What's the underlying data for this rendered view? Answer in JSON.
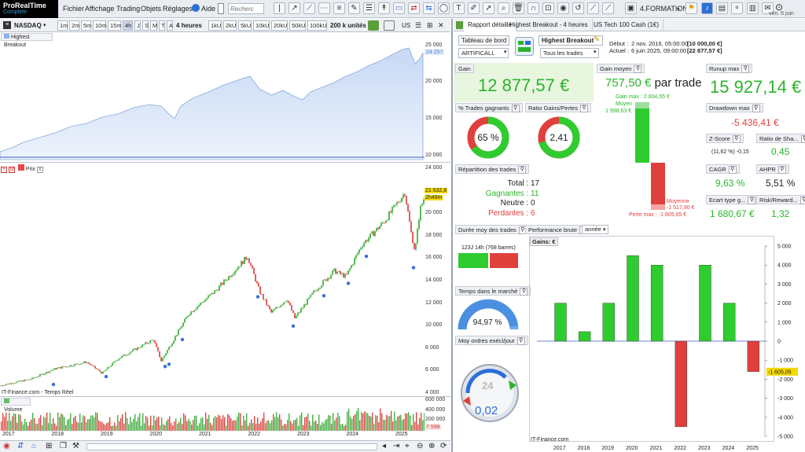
{
  "topbar": {
    "logo_title": "ProRealTime",
    "logo_sub": "Complete",
    "menus": [
      "Fichier",
      "Affichage",
      "Trading",
      "Objets",
      "Réglages",
      "Aide"
    ],
    "search_placeholder": "Recherc",
    "workspace": "4.FORMATION",
    "date": "ven. 6 juin"
  },
  "chart_toolbar": {
    "instrument": "NASDAQ",
    "timeframes": [
      "1m",
      "2m",
      "5m",
      "10m",
      "15m",
      "4h",
      "J",
      "S",
      "M",
      "T",
      "A"
    ],
    "period": "4 heures",
    "ticks": [
      "1kU",
      "2kU",
      "5kU",
      "10kU",
      "20kU",
      "50kU",
      "100kU"
    ],
    "units": "200 k unités",
    "region": "US"
  },
  "left_chart": {
    "equity_label": "Highest Breakout",
    "equity_axis": [
      "25 000",
      "20 000",
      "15 000",
      "10 000"
    ],
    "equity_last": "24 257",
    "price_label": "Prix",
    "price_axis": [
      "24 000",
      "22 000",
      "20 000",
      "18 000",
      "16 000",
      "14 000",
      "12 000",
      "10 000",
      "8 000",
      "6 000",
      "4 000"
    ],
    "price_last": "21 632,8",
    "countdown": "2h49m",
    "source": "IT-Finance.com - Temps Réel",
    "volume_label": "Volume",
    "volume_axis": [
      "600 000",
      "400 000",
      "200 000"
    ],
    "volume_last": "7 598",
    "years": [
      "2017",
      "2018",
      "2019",
      "2020",
      "2021",
      "2022",
      "2023",
      "2024",
      "2025"
    ]
  },
  "report": {
    "tabs": [
      "Rapport détaillé",
      "Highest Breakout - 4 heures",
      "US Tech 100 Cash (1€)"
    ],
    "dashboard_label": "Tableau de bord",
    "dashboard_value": "ARTIFICALL",
    "system_name": "Highest Breakout",
    "trades_filter": "Tous les trades",
    "debut_label": "Début :",
    "debut_value": "2 nov. 2016, 05:00:00",
    "debut_capital": "[10 000,00 €]",
    "actuel_label": "Actuel :",
    "actuel_value": "6 juin 2025, 09:00:00",
    "actuel_capital": "[22 877,57 €]",
    "gain_label": "Gain",
    "gain_value": "12 877,57 €",
    "gain_moyen_label": "Gain moyen",
    "gain_moyen_value": "757,50 €",
    "gain_moyen_suffix": "par trade",
    "gain_max": "Gain max : 2 004,55 €",
    "moyen_label": "Moyen",
    "moyen_value": "1 998,63 €",
    "moyenne_label": "Moyenne",
    "moyenne_value": "-1 517,90 €",
    "perte_max": "Perte max : -1 605,05 €",
    "runup_label": "Runup max",
    "runup_value": "15 927,14 €",
    "drawdown_label": "Drawdown max",
    "drawdown_value": "-5 436,41 €",
    "pct_gagnants_label": "% Trades gagnants",
    "pct_gagnants_value": "65 %",
    "ratio_label": "Ratio Gains/Pertes",
    "ratio_value": "2,41",
    "zscore_label": "Z-Score",
    "zscore_sub": "(11,62 %) -0,15",
    "sharpe_label": "Ratio de Sha...",
    "sharpe_value": "0,45",
    "repartition_label": "Répartition des trades",
    "total_label": "Total :",
    "total_value": "17",
    "gagnantes_label": "Gagnantes :",
    "gagnantes_value": "11",
    "neutre_label": "Neutre :",
    "neutre_value": "0",
    "perdantes_label": "Perdantes :",
    "perdantes_value": "6",
    "cagr_label": "CAGR",
    "cagr_value": "9,63 %",
    "ahpr_label": "AHPR",
    "ahpr_value": "5,51 %",
    "ecart_label": "Ecart type g...",
    "ecart_value": "1 680,67 €",
    "risk_label": "Risk/Reward...",
    "risk_value": "1,32",
    "duree_label": "Durée moy des trades",
    "duree_value": "123J 14h (768 barres)",
    "temps_label": "Temps dans le marché",
    "temps_value": "94,97 %",
    "moy_ordres_label": "Moy ordres exécl/jour",
    "moy_ordres_value": "0,02",
    "gauge_num": "24",
    "perf_label": "Performance brute",
    "perf_period": "année",
    "gains_label": "Gains: €",
    "source": "IT-Finance.com",
    "last_value": "-1 605,05"
  },
  "colors": {
    "green": "#2bb42b",
    "red": "#e0403c",
    "blue": "#4a7fd8",
    "gauge_blue": "#6aa8ee"
  },
  "chart_data": {
    "type": "bar",
    "categories": [
      "2017",
      "2018",
      "2019",
      "2020",
      "2021",
      "2022",
      "2023",
      "2024",
      "2025"
    ],
    "values": [
      2000,
      500,
      2000,
      4500,
      4000,
      -4500,
      4000,
      2000,
      -1605.05
    ],
    "ylim": [
      -5000,
      5000
    ],
    "yticks": [
      "5 000",
      "4 000",
      "3 000",
      "2 000",
      "1 000",
      "0",
      "-1 000",
      "-2 000",
      "-3 000",
      "-4 000",
      "-5 000"
    ]
  }
}
